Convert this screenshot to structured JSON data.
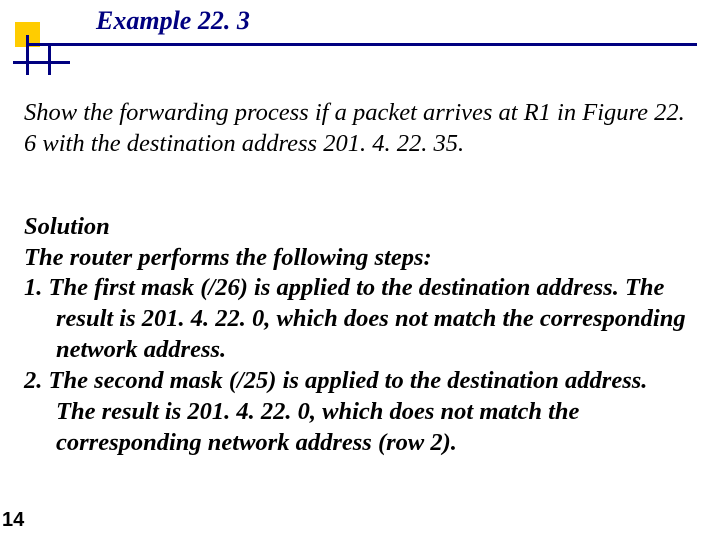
{
  "header": {
    "title": "Example 22. 3"
  },
  "content": {
    "problem": "Show the forwarding process if a packet arrives at R1 in Figure 22. 6 with the destination address 201. 4. 22. 35.",
    "solution_label": "Solution",
    "solution_intro": "The router performs the following steps:",
    "steps": [
      {
        "num": "1.",
        "text": "The first mask (/26) is applied to the destination address. The result is 201. 4. 22. 0, which does not match the corresponding network address."
      },
      {
        "num": "2.",
        "text": "The second mask (/25) is applied to the destination address. The result is 201. 4. 22. 0, which does not match the corresponding network address (row 2)."
      }
    ]
  },
  "page_number": "14"
}
